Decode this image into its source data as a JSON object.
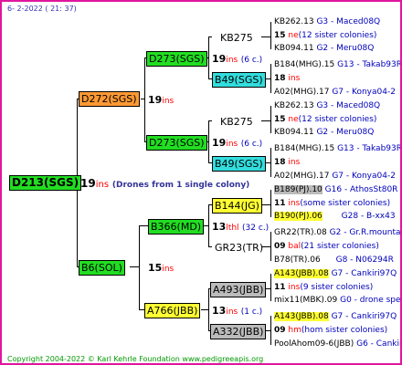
{
  "header": {
    "date": "6-  2-2022 ( 21: 37)"
  },
  "footer": {
    "copyright": "Copyright 2004-2022 © Karl Kehrle Foundation     www.pedigreeapis.org"
  },
  "root": {
    "id": "D213(SGS)",
    "count": "19",
    "unit": "ins",
    "note": "(Drones from 1 single colony)"
  },
  "gen1": [
    {
      "id": "D272(SGS)",
      "count": "19",
      "unit": "ins"
    },
    {
      "id": "B6(SOL)",
      "count": "15",
      "unit": "ins"
    }
  ],
  "gen2": [
    {
      "id": "D273(SGS)",
      "count": "19",
      "unit": "ins",
      "extra": "(6 c.)"
    },
    {
      "id": "D273(SGS)",
      "count": "19",
      "unit": "ins",
      "extra": "(6 c.)"
    },
    {
      "id": "B366(MD)",
      "count": "13",
      "unit": "lthl",
      "extra": "(32 c.)"
    },
    {
      "id": "A766(JBB)",
      "count": "13",
      "unit": "ins",
      "extra": "(1 c.)"
    }
  ],
  "gen3": [
    {
      "id": "KB275"
    },
    {
      "id": "B49(SGS)"
    },
    {
      "id": "KB275"
    },
    {
      "id": "B49(SGS)"
    },
    {
      "id": "B144(JG)"
    },
    {
      "id": "GR23(TR)"
    },
    {
      "id": "A493(JBB)"
    },
    {
      "id": "A332(JBB)"
    }
  ],
  "gen4": [
    {
      "a": "KB262.13",
      "a2": "G3 - Maced08Q",
      "num": "15",
      "ne": "ne",
      "mid": "(12 sister colonies)",
      "b": "KB094.11",
      "b2": "G2 - Meru08Q"
    },
    {
      "a": "B184(MHG).15",
      "a2": "G13 - Takab93R",
      "num": "18",
      "ne": "ins",
      "mid": "",
      "b": "A02(MHG).17",
      "b2": "G7 - Konya04-2"
    },
    {
      "a": "KB262.13",
      "a2": "G3 - Maced08Q",
      "num": "15",
      "ne": "ne",
      "mid": "(12 sister colonies)",
      "b": "KB094.11",
      "b2": "G2 - Meru08Q"
    },
    {
      "a": "B184(MHG).15",
      "a2": "G13 - Takab93R",
      "num": "18",
      "ne": "ins",
      "mid": "",
      "b": "A02(MHG).17",
      "b2": "G7 - Konya04-2"
    },
    {
      "a": "B189(PJ).10",
      "a2": "G16 - AthosSt80R",
      "num": "11",
      "ne": "ins",
      "mid": "(some sister colonies)",
      "b": "B190(PJ).06",
      "b2": "G28 - B-xx43"
    },
    {
      "a": "GR22(TR).08",
      "a2": "G2 - Gr.R.mounta",
      "num": "09",
      "ne": "bal",
      "mid": "(21 sister colonies)",
      "b": "B78(TR).06",
      "b2": "G8 - N06294R"
    },
    {
      "a": "A143(JBB).08",
      "a2": "G7 - Cankiri97Q",
      "num": "11",
      "ne": "ins",
      "mid": "(9 sister colonies)",
      "b": "mix11(MBK).09",
      "b2": "G0 - drone sperm"
    },
    {
      "a": "A143(JBB).08",
      "a2": "G7 - Cankiri97Q",
      "num": "09",
      "ne": "hm",
      "mid": "(hom sister colonies)",
      "b": "PoolAhom09-6(JBB)",
      "b2": "G6 - Cankiri97Q"
    }
  ]
}
